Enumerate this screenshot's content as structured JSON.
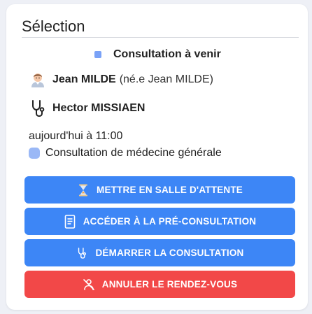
{
  "card": {
    "title": "Sélection",
    "status": {
      "label": "Consultation à venir",
      "color": "#7aa2f7"
    },
    "patient": {
      "icon": "patient-avatar-icon",
      "name": "Jean MILDE",
      "birth_name": "(né.e Jean MILDE)"
    },
    "doctor": {
      "icon": "stethoscope-icon",
      "name": "Hector MISSIAEN"
    },
    "datetime": "aujourd'hui à 11:00",
    "consultation_type": {
      "label": "Consultation de médecine générale",
      "color": "#9ab8f6"
    }
  },
  "actions": [
    {
      "label": "METTRE EN SALLE D'ATTENTE",
      "icon": "hourglass-icon",
      "color": "#3d86f6"
    },
    {
      "label": "ACCÉDER À LA PRÉ-CONSULTATION",
      "icon": "document-icon",
      "color": "#3d86f6"
    },
    {
      "label": "DÉMARRER LA CONSULTATION",
      "icon": "stethoscope-icon",
      "color": "#3d86f6"
    },
    {
      "label": "ANNULER LE RENDEZ-VOUS",
      "icon": "cancel-appointment-icon",
      "color": "#f24848"
    }
  ]
}
